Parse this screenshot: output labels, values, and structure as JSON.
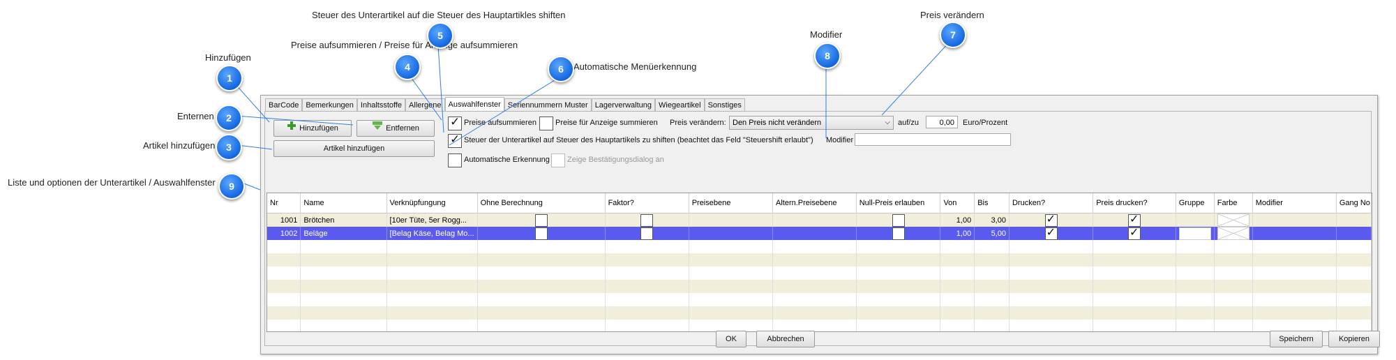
{
  "callouts": [
    {
      "num": "1",
      "text": "Hinzufügen"
    },
    {
      "num": "2",
      "text": "Enternen"
    },
    {
      "num": "3",
      "text": "Artikel hinzufügen"
    },
    {
      "num": "4",
      "text": "Preise aufsummieren / Preise für Anzeige aufsummieren"
    },
    {
      "num": "5",
      "text": "Steuer des Unterartikel auf die Steuer des Hauptartikles shiften"
    },
    {
      "num": "6",
      "text": "Automatische Menüerkennung"
    },
    {
      "num": "7",
      "text": "Preis verändern"
    },
    {
      "num": "8",
      "text": "Modifier"
    },
    {
      "num": "9",
      "text": "Liste und optionen der Unterartikel / Auswahlfenster"
    }
  ],
  "tabs": [
    "BarCode",
    "Bemerkungen",
    "Inhaltsstoffe",
    "Allergene",
    "Auswahlfenster",
    "Seriennummern Muster",
    "Lagerverwaltung",
    "Wiegeartikel",
    "Sonstiges"
  ],
  "active_tab": "Auswahlfenster",
  "buttons": {
    "add": "Hinzufügen",
    "remove": "Entfernen",
    "add_article": "Artikel hinzufügen",
    "ok": "OK",
    "cancel": "Abbrechen",
    "save": "Speichern",
    "copy": "Kopieren"
  },
  "options": {
    "sum_prices": "Preise aufsummieren",
    "sum_display_prices": "Preise für Anzeige summieren",
    "price_change_label": "Preis verändern:",
    "price_change_value": "Den Preis nicht verändern",
    "auf_zu": "auf/zu",
    "amount": "0,00",
    "unit": "Euro/Prozent",
    "tax_shift": "Steuer der Unterartikel auf Steuer des Hauptartikels zu shiften (beachtet das Feld \"Steuershift erlaubt\")",
    "modifier_label": "Modifier",
    "modifier_value": "",
    "auto_detect": "Automatische Erkennung",
    "confirm_dialog": "Zeige Bestätigungsdialog an"
  },
  "checks": {
    "sum_prices": true,
    "sum_display_prices": false,
    "tax_shift": true,
    "auto_detect": false,
    "confirm_dialog": false
  },
  "table": {
    "columns": [
      "Nr",
      "Name",
      "Verknüpfungung",
      "Ohne Berechnung",
      "Faktor?",
      "Preisebene",
      "Altern.Preisebene",
      "Null-Preis erlauben",
      "Von",
      "Bis",
      "Drucken?",
      "Preis drucken?",
      "Gruppe",
      "Farbe",
      "Modifier",
      "Gang No"
    ],
    "rows": [
      {
        "nr": "1001",
        "name": "Brötchen",
        "link": "[10er Tüte, 5er Rogg...",
        "ohne": false,
        "faktor": false,
        "null": false,
        "von": "1,00",
        "bis": "3,00",
        "drucken": true,
        "preis_drucken": true
      },
      {
        "nr": "1002",
        "name": "Beläge",
        "link": "[Belag Käse, Belag Mo...",
        "ohne": false,
        "faktor": false,
        "null": false,
        "von": "1,00",
        "bis": "5,00",
        "drucken": true,
        "preis_drucken": true
      }
    ]
  },
  "colors": {
    "badge": "#1467e0",
    "selected_row": "#5a5aee",
    "alt_row": "#f1efdc"
  }
}
